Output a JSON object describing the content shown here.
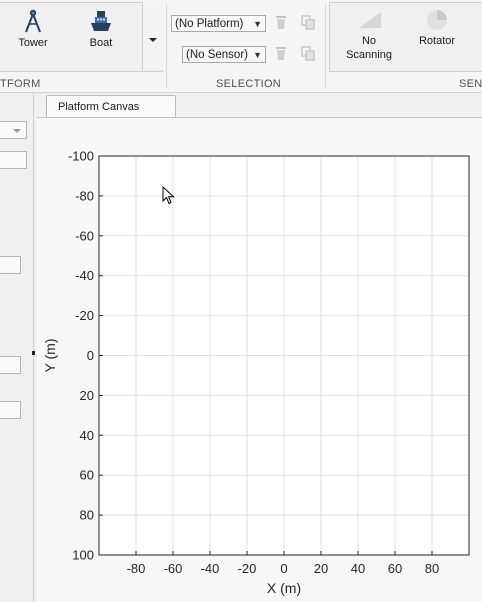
{
  "toolstrip": {
    "platform_section": {
      "label_fragment": "TFORM",
      "buttons": [
        {
          "label": "Tower",
          "icon": "tower-icon"
        },
        {
          "label": "Boat",
          "icon": "boat-icon"
        }
      ]
    },
    "selection_section": {
      "label": "SELECTION",
      "platform_combo": "(No Platform)",
      "sensor_combo": "(No Sensor)"
    },
    "sensor_section": {
      "label_fragment": "SENS",
      "buttons": [
        {
          "label_line1": "No",
          "label_line2": "Scanning",
          "icon": "no-scanning-icon"
        },
        {
          "label_line1": "Rotator",
          "label_line2": "",
          "icon": "rotator-icon"
        }
      ]
    }
  },
  "tabs": [
    {
      "label": "Platform Canvas"
    }
  ],
  "axes_toolbar": [
    "pan-icon",
    "zoom-in-icon",
    "zoom-out-icon",
    "home-icon"
  ],
  "colors": {
    "grid": "#e1e1e1",
    "axis": "#262626",
    "plot_bg": "#ffffff"
  },
  "chart_data": {
    "type": "scatter",
    "xlabel": "X (m)",
    "ylabel": "Y (m)",
    "xlim": [
      -100,
      100
    ],
    "ylim": [
      -100,
      100
    ],
    "y_reversed": true,
    "x_ticks": [
      -80,
      -60,
      -40,
      -20,
      0,
      20,
      40,
      60,
      80
    ],
    "y_ticks": [
      -100,
      -80,
      -60,
      -40,
      -20,
      0,
      20,
      40,
      60,
      80,
      100
    ],
    "grid": true,
    "series": []
  }
}
